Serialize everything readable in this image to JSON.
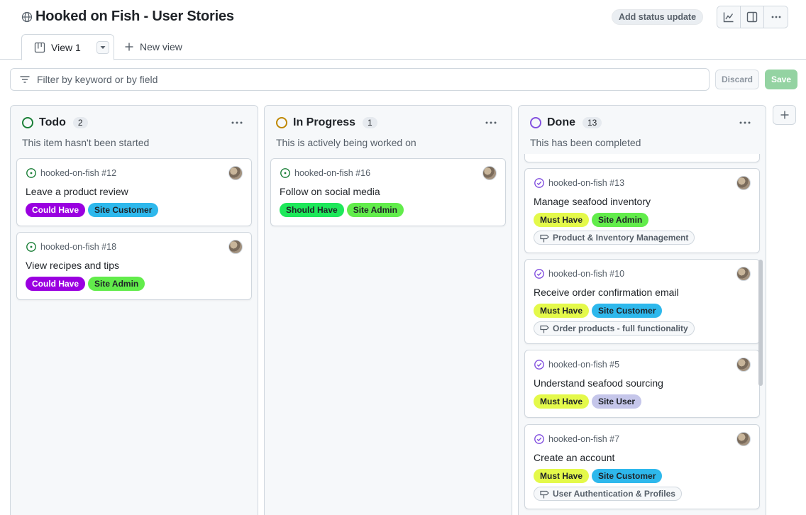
{
  "header": {
    "title": "Hooked on Fish - User Stories",
    "status_update_label": "Add status update",
    "icons": [
      "globe-icon",
      "insights-icon",
      "sidebar-icon",
      "kebab-icon"
    ]
  },
  "tabs": {
    "active_label": "View 1",
    "new_view_label": "New view"
  },
  "filter": {
    "placeholder": "Filter by keyword or by field",
    "discard_label": "Discard",
    "save_label": "Save"
  },
  "colors": {
    "todo": "#1a7f37",
    "in_progress": "#bf8700",
    "done": "#8250df",
    "could_have": "#9a00e0",
    "should_have": "#1ee85a",
    "must_have": "#e4f94a",
    "site_customer": "#2eb8ec",
    "site_admin": "#62ec4b",
    "site_user": "#c5c6ea"
  },
  "columns": {
    "todo": {
      "name": "Todo",
      "count": "2",
      "description": "This item hasn't been started",
      "cards": [
        {
          "ref": "hooked-on-fish #12",
          "title": "Leave a product review",
          "labels": [
            "Could Have",
            "Site Customer"
          ]
        },
        {
          "ref": "hooked-on-fish #18",
          "title": "View recipes and tips",
          "labels": [
            "Could Have",
            "Site Admin"
          ]
        }
      ]
    },
    "in_progress": {
      "name": "In Progress",
      "count": "1",
      "description": "This is actively being worked on",
      "cards": [
        {
          "ref": "hooked-on-fish #16",
          "title": "Follow on social media",
          "labels": [
            "Should Have",
            "Site Admin"
          ]
        }
      ]
    },
    "done": {
      "name": "Done",
      "count": "13",
      "description": "This has been completed",
      "cards": [
        {
          "ref": "hooked-on-fish #13",
          "title": "Manage seafood inventory",
          "labels": [
            "Must Have",
            "Site Admin"
          ],
          "milestone": "Product & Inventory Management"
        },
        {
          "ref": "hooked-on-fish #10",
          "title": "Receive order confirmation email",
          "labels": [
            "Must Have",
            "Site Customer"
          ],
          "milestone": "Order products - full functionality"
        },
        {
          "ref": "hooked-on-fish #5",
          "title": "Understand seafood sourcing",
          "labels": [
            "Must Have",
            "Site User"
          ]
        },
        {
          "ref": "hooked-on-fish #7",
          "title": "Create an account",
          "labels": [
            "Must Have",
            "Site Customer"
          ],
          "milestone": "User Authentication & Profiles"
        }
      ]
    }
  }
}
